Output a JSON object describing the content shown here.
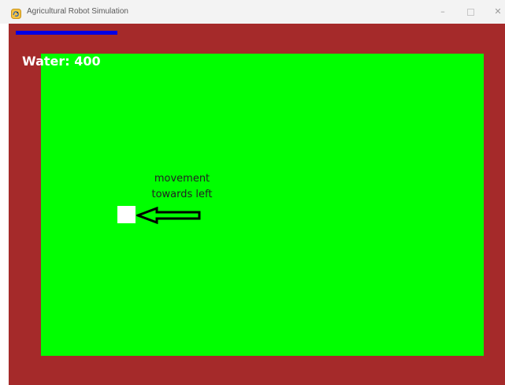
{
  "window": {
    "title": "Agricultural Robot Simulation",
    "icon": "pygame-snake-icon",
    "controls": {
      "minimize": "minimize-icon",
      "maximize": "maximize-icon",
      "close": "close-icon"
    }
  },
  "game": {
    "water_label": "Water: 400",
    "water_level_fraction": 0.4,
    "annotation_line1": "movement",
    "annotation_line2": "towards left",
    "colors": {
      "background": "#a52a2a",
      "field": "#00ff00",
      "water_bar": "#0000e6",
      "robot": "#ffffff"
    }
  }
}
